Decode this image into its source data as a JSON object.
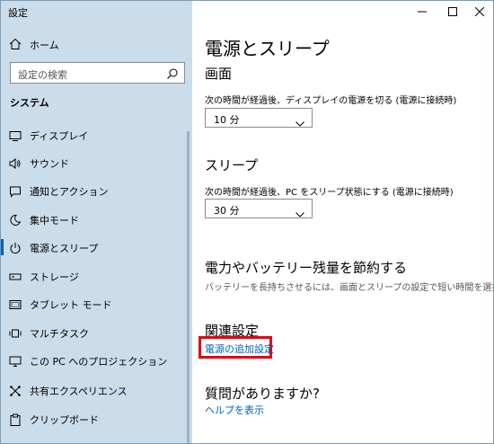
{
  "window": {
    "title": "設定",
    "controls": [
      "minimize-icon",
      "maximize-icon",
      "close-icon"
    ]
  },
  "sidebar": {
    "home_label": "ホーム",
    "search_placeholder": "設定の検索",
    "section_label": "システム",
    "items": [
      {
        "label": "ディスプレイ",
        "icon": "display-icon"
      },
      {
        "label": "サウンド",
        "icon": "speaker-icon"
      },
      {
        "label": "通知とアクション",
        "icon": "notification-icon"
      },
      {
        "label": "集中モード",
        "icon": "moon-icon"
      },
      {
        "label": "電源とスリープ",
        "icon": "power-icon",
        "selected": true
      },
      {
        "label": "ストレージ",
        "icon": "storage-icon"
      },
      {
        "label": "タブレット モード",
        "icon": "tablet-icon"
      },
      {
        "label": "マルチタスク",
        "icon": "multitask-icon"
      },
      {
        "label": "この PC へのプロジェクション",
        "icon": "projection-icon"
      },
      {
        "label": "共有エクスペリエンス",
        "icon": "shared-experience-icon"
      },
      {
        "label": "クリップボード",
        "icon": "clipboard-icon"
      }
    ]
  },
  "main": {
    "title": "電源とスリープ",
    "screen": {
      "heading": "画面",
      "description": "次の時間が経過後、ディスプレイの電源を切る (電源に接続時)",
      "value": "10 分"
    },
    "sleep": {
      "heading": "スリープ",
      "description": "次の時間が経過後、PC をスリープ状態にする (電源に接続時)",
      "value": "30 分"
    },
    "battery": {
      "heading": "電力やバッテリー残量を節約する",
      "description": "バッテリーを長持ちさせるには、画面とスリープの設定で短い時間を選択します。"
    },
    "related": {
      "heading": "関連設定",
      "link": "電源の追加設定"
    },
    "help": {
      "heading": "質問がありますか?",
      "link": "ヘルプを表示"
    }
  },
  "colors": {
    "sidebar_bg": "#cbdcea",
    "accent": "#0063b1",
    "highlight_border": "#e60012"
  }
}
